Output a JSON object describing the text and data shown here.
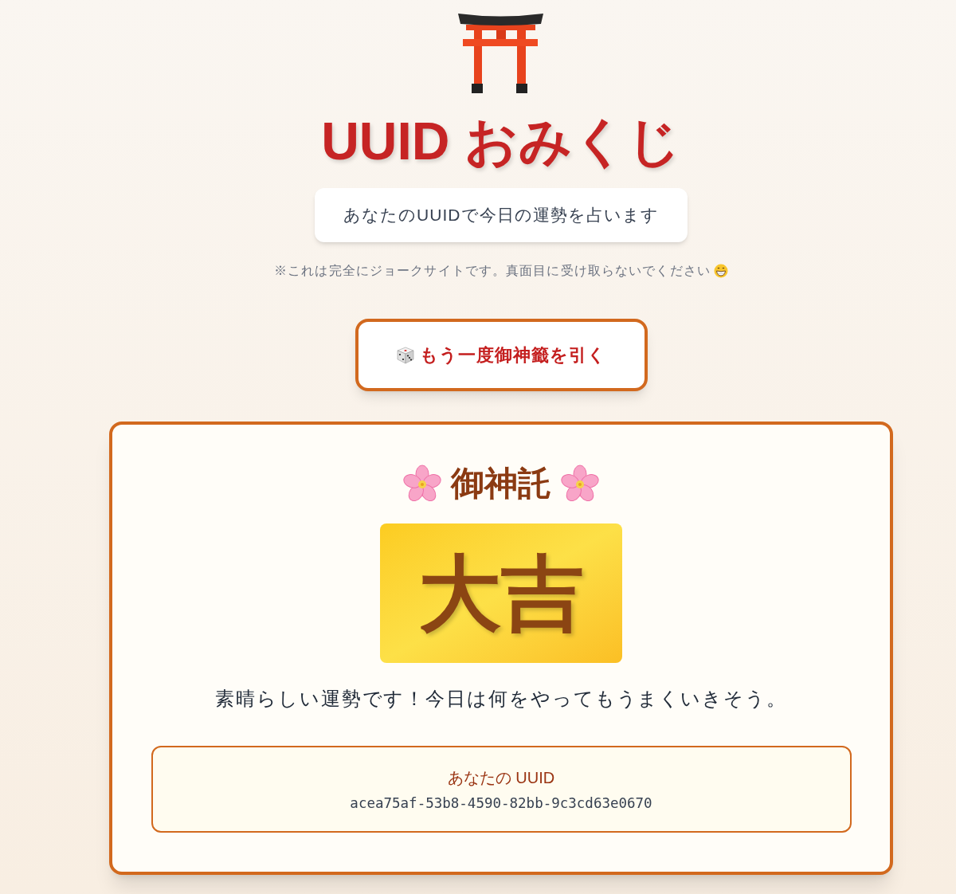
{
  "header": {
    "title": "UUID おみくじ",
    "tagline": "あなたのUUIDで今日の運勢を占います",
    "disclaimer": "※これは完全にジョークサイトです。真面目に受け取らないでください"
  },
  "draw_button": {
    "label": "もう一度御神籤を引く"
  },
  "result": {
    "heading": "御神託",
    "fortune": "大吉",
    "message": "素晴らしい運勢です！今日は何をやってもうまくいきそう。",
    "uuid_label": "あなたの UUID",
    "uuid": "acea75af-53b8-4590-82bb-9c3cd63e0670"
  }
}
